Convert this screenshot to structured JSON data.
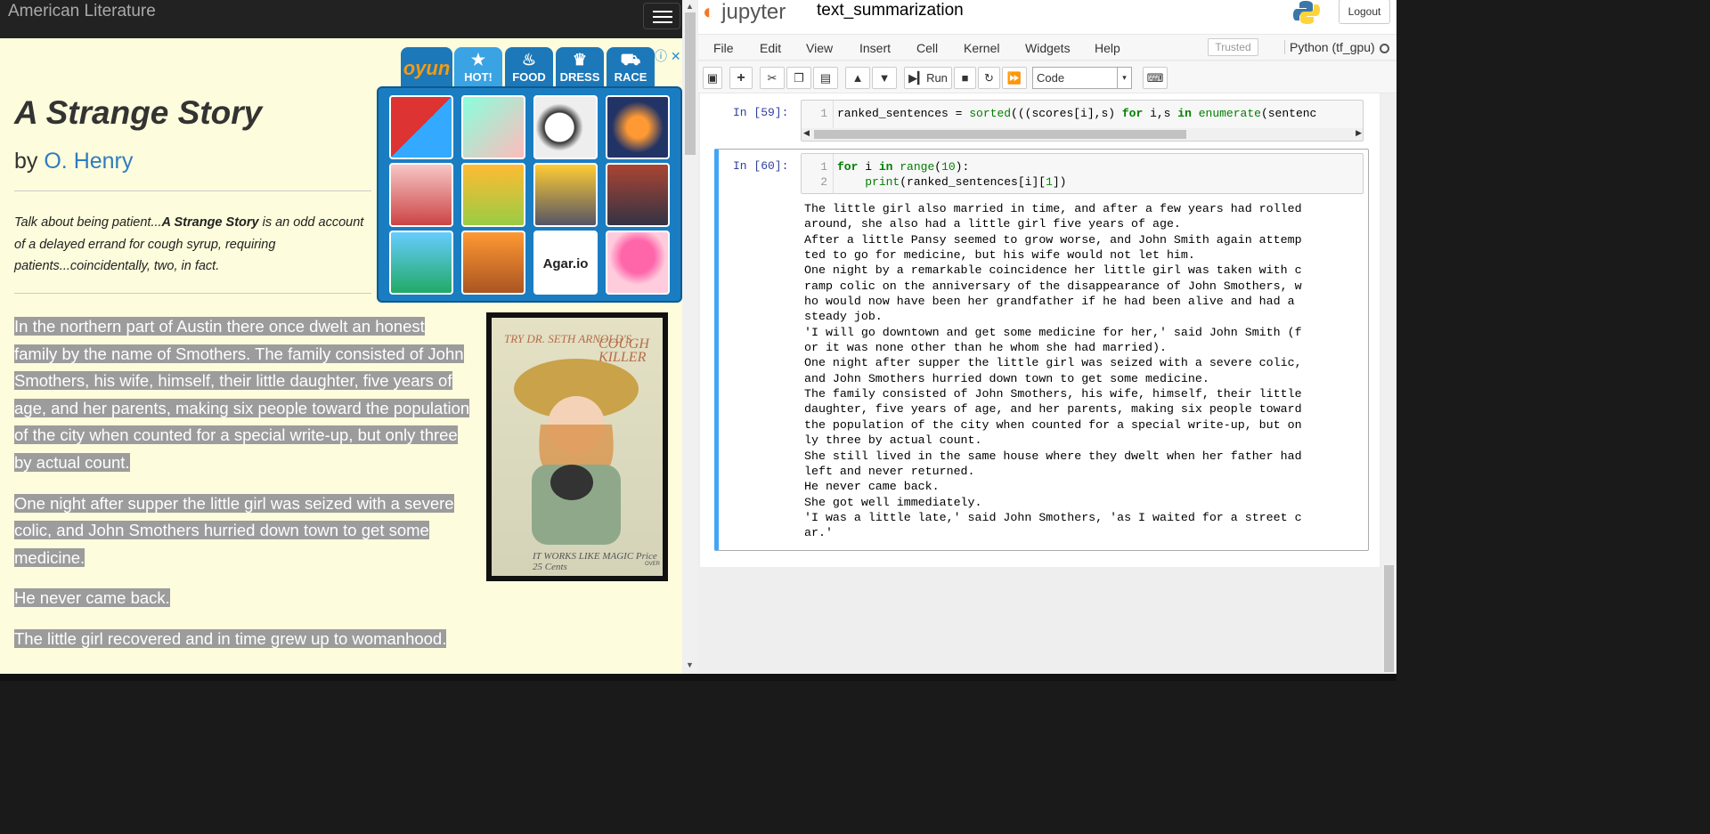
{
  "left": {
    "site_name": "American Literature",
    "title": "A Strange Story",
    "by": "by",
    "author": "O. Henry",
    "description": {
      "part1": "Talk about being patient...",
      "bold": "A Strange Story",
      "part2": " is an odd account of a delayed errand for cough syrup, requiring patients...coincidentally, two, in fact."
    },
    "paragraphs": [
      "In the northern part of Austin there once dwelt an honest family by the name of Smothers. The family consisted of John Smothers, his wife, himself, their little daughter, five years of age, and her parents, making six people toward the population of the city when counted for a special write-up, but only three by actual count.",
      "One night after supper the little girl was seized with a severe colic, and John Smothers hurried down town to get some medicine.",
      "He never came back.",
      "The little girl recovered and in time grew up to womanhood."
    ],
    "ad": {
      "oyun": "oyun",
      "tabs": [
        "HOT!",
        "FOOD",
        "DRESS",
        "RACE"
      ],
      "close": "ⓘ ✕",
      "agar_label": "Agar.io"
    },
    "card": {
      "try": "TRY DR. SETH ARNOLD'S",
      "cough": "COUGH KILLER",
      "bottom": "IT WORKS LIKE MAGIC  Price 25 Cents",
      "over": "OVER"
    }
  },
  "jupyter": {
    "logo": "jupyter",
    "notebook_name": "text_summarization",
    "logout": "Logout",
    "menu": [
      "File",
      "Edit",
      "View",
      "Insert",
      "Cell",
      "Kernel",
      "Widgets",
      "Help"
    ],
    "trusted": "Trusted",
    "kernel": "Python (tf_gpu)",
    "run_label": "Run",
    "cell_type": "Code",
    "cells": [
      {
        "prompt": "In [59]:",
        "lines": [
          "ranked_sentences = sorted(((scores[i],s) for i,s in enumerate(sentenc"
        ]
      },
      {
        "prompt": "In [60]:",
        "lines": [
          "for i in range(10):",
          "    print(ranked_sentences[i][1])"
        ]
      }
    ],
    "output": "The little girl also married in time, and after a few years had rolled\naround, she also had a little girl five years of age.\nAfter a little Pansy seemed to grow worse, and John Smith again attemp\nted to go for medicine, but his wife would not let him.\nOne night by a remarkable coincidence her little girl was taken with c\nramp colic on the anniversary of the disappearance of John Smothers, w\nho would now have been her grandfather if he had been alive and had a\nsteady job.\n'I will go downtown and get some medicine for her,' said John Smith (f\nor it was none other than he whom she had married).\nOne night after supper the little girl was seized with a severe colic,\nand John Smothers hurried down town to get some medicine.\nThe family consisted of John Smothers, his wife, himself, their little\ndaughter, five years of age, and her parents, making six people toward\nthe population of the city when counted for a special write-up, but on\nly three by actual count.\nShe still lived in the same house where they dwelt when her father had\nleft and never returned.\nHe never came back.\nShe got well immediately.\n'I was a little late,' said John Smothers, 'as I waited for a street c\nar.'"
  },
  "colors": {
    "page_bg": "#fdfcdc",
    "selection": "#9c9c9c",
    "author_link": "#2f7cc0",
    "jupyter_orange": "#f37726",
    "prompt_blue": "#303f9f",
    "cell_selected": "#42a5f5"
  }
}
